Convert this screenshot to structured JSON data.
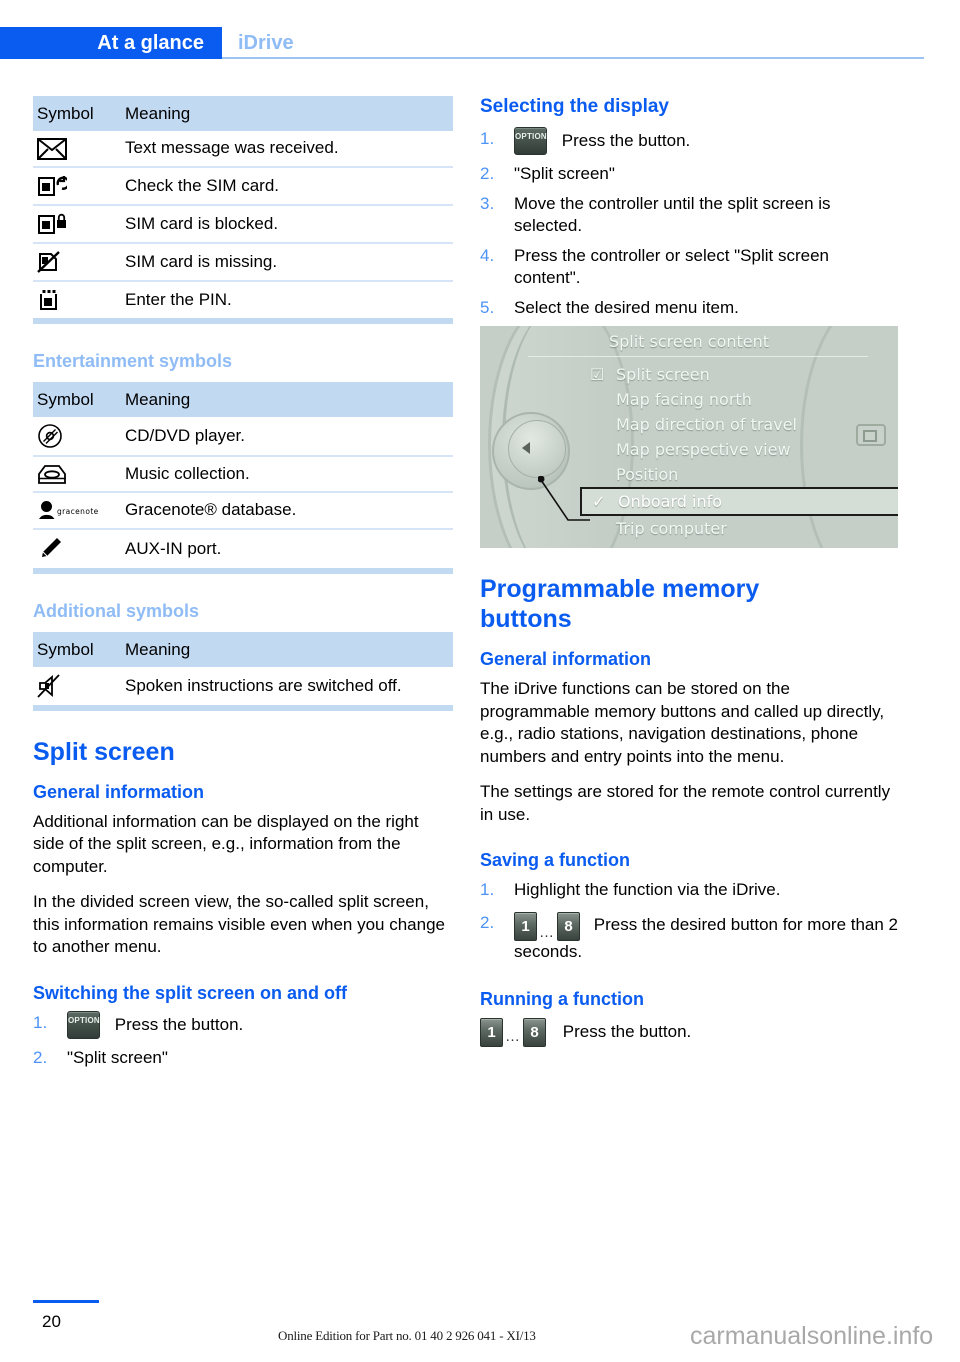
{
  "header": {
    "active_tab": "At a glance",
    "inactive_tab": "iDrive"
  },
  "left_column": {
    "phone_table": {
      "columns": [
        "Symbol",
        "Meaning"
      ],
      "rows": [
        {
          "icon": "envelope-icon",
          "meaning": "Text message was received."
        },
        {
          "icon": "sim-check-icon",
          "meaning": "Check the SIM card."
        },
        {
          "icon": "sim-locked-icon",
          "meaning": "SIM card is blocked."
        },
        {
          "icon": "sim-missing-icon",
          "meaning": "SIM card is missing."
        },
        {
          "icon": "sim-pin-icon",
          "meaning": "Enter the PIN."
        }
      ]
    },
    "entertainment": {
      "heading": "Entertainment symbols",
      "columns": [
        "Symbol",
        "Meaning"
      ],
      "rows": [
        {
          "icon": "cd-dvd-icon",
          "meaning": "CD/DVD player."
        },
        {
          "icon": "music-collection-icon",
          "meaning": "Music collection."
        },
        {
          "icon": "gracenote-icon",
          "meaning": "Gracenote® database."
        },
        {
          "icon": "aux-in-icon",
          "meaning": "AUX-IN port."
        }
      ]
    },
    "additional": {
      "heading": "Additional symbols",
      "columns": [
        "Symbol",
        "Meaning"
      ],
      "rows": [
        {
          "icon": "speaker-muted-icon",
          "meaning": "Spoken instructions are switched off."
        }
      ]
    },
    "split_screen": {
      "title": "Split screen",
      "general_information": {
        "heading": "General information",
        "paragraphs": [
          "Additional information can be displayed on the right side of the split screen, e.g., information from the computer.",
          "In the divided screen view, the so-called split screen, this information remains visible even when you change to another menu."
        ]
      },
      "switching": {
        "heading": "Switching the split screen on and off",
        "steps": [
          {
            "number": "1.",
            "icon": "option-button-icon",
            "icon_label": "OPTION",
            "text": "Press the button."
          },
          {
            "number": "2.",
            "text": "\"Split screen\""
          }
        ]
      }
    }
  },
  "right_column": {
    "selecting_display": {
      "heading": "Selecting the display",
      "steps": [
        {
          "number": "1.",
          "icon": "option-button-icon",
          "icon_label": "OPTION",
          "text": "Press the button."
        },
        {
          "number": "2.",
          "text": "\"Split screen\""
        },
        {
          "number": "3.",
          "text": "Move the controller until the split screen is selected."
        },
        {
          "number": "4.",
          "text": "Press the controller or select \"Split screen content\"."
        },
        {
          "number": "5.",
          "text": "Select the desired menu item."
        }
      ]
    },
    "idrive_screenshot": {
      "title": "Split screen content",
      "menu_items": [
        {
          "label": "Split screen",
          "mark": "checkbox-checked-icon",
          "highlighted": false
        },
        {
          "label": "Map facing north",
          "mark": "",
          "highlighted": false
        },
        {
          "label": "Map direction of travel",
          "mark": "",
          "highlighted": false
        },
        {
          "label": "Map perspective view",
          "mark": "",
          "highlighted": false
        },
        {
          "label": "Position",
          "mark": "",
          "highlighted": false
        },
        {
          "label": "Onboard info",
          "mark": "check-icon",
          "highlighted": true
        },
        {
          "label": "Trip computer",
          "mark": "",
          "highlighted": false
        }
      ]
    },
    "memory_buttons": {
      "title": "Programmable memory buttons",
      "general_information": {
        "heading": "General information",
        "paragraphs": [
          "The iDrive functions can be stored on the programmable memory buttons and called up directly, e.g., radio stations, navigation destinations, phone numbers and entry points into the menu.",
          "The settings are stored for the remote control currently in use."
        ]
      },
      "saving": {
        "heading": "Saving a function",
        "steps": [
          {
            "number": "1.",
            "text": "Highlight the function via the iDrive."
          },
          {
            "number": "2.",
            "icon": "memory-buttons-icon",
            "btn_first": "1",
            "btn_dots": "…",
            "btn_last": "8",
            "text": "Press the desired button for more than 2 seconds."
          }
        ]
      },
      "running": {
        "heading": "Running a function",
        "btn_first": "1",
        "btn_dots": "…",
        "btn_last": "8",
        "text": "Press the button."
      }
    }
  },
  "footer": {
    "page_number": "20",
    "edition": "Online Edition for Part no. 01 40 2 926 041 - XI/13",
    "watermark": "carmanualsonline.info"
  },
  "colors": {
    "brand_blue": "#0a5cf0",
    "light_blue": "#8fbcf5",
    "table_header_bg": "#c2d9f2",
    "row_divider": "#d5e5f7"
  }
}
